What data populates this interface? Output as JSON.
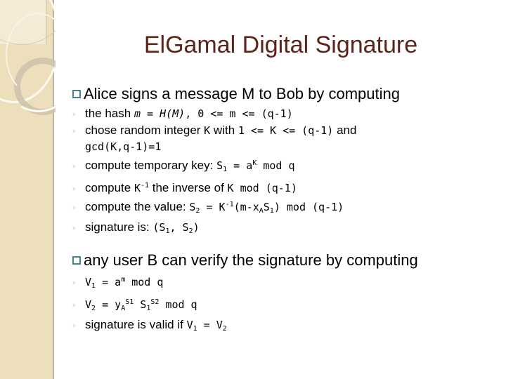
{
  "slide": {
    "title": "ElGamal Digital Signature",
    "title_color": "#5B2418",
    "background_color": "#FFFFFF",
    "decoration": {
      "band_color": "#EDDFBC",
      "band_light_color": "#F4EBD6",
      "ring_color": "#CCC2AB",
      "highlight_color": "#FDFAF1",
      "border_color": "#B9B4A2"
    },
    "bullet_markers": {
      "level1": "hollow-square",
      "level1_color": "#4A7F8C",
      "level2": "◦",
      "level2_color": "#9FB4BD"
    }
  },
  "sections": [
    {
      "heading": "Alice signs a message M to Bob by computing",
      "items": [
        {
          "parts": [
            {
              "style": "text",
              "t": "the hash "
            },
            {
              "style": "mono-italic",
              "t": "m"
            },
            {
              "style": "mono",
              "t": " = "
            },
            {
              "style": "mono-italic",
              "t": "H(M)"
            },
            {
              "style": "mono",
              "t": ", 0 <= m <= (q-1)"
            }
          ],
          "plain": "the hash m = H(M), 0 <= m <= (q-1)"
        },
        {
          "parts": [
            {
              "style": "text",
              "t": "chose random integer "
            },
            {
              "style": "mono",
              "t": "K"
            },
            {
              "style": "text",
              "t": " with "
            },
            {
              "style": "mono",
              "t": "1 <= K <= (q-1)"
            },
            {
              "style": "text",
              "t": " and"
            }
          ],
          "plain": "chose random integer K with 1 <= K <= (q-1) and",
          "continuation": "gcd(K,q-1)=1"
        },
        {
          "parts": [
            {
              "style": "text",
              "t": "compute temporary key: "
            },
            {
              "style": "mono",
              "t": "S1 = aK mod q"
            }
          ],
          "plain": "compute temporary key: S1 = a^K mod q"
        },
        {
          "parts": [
            {
              "style": "text",
              "t": "compute "
            },
            {
              "style": "mono",
              "t": "K-1"
            },
            {
              "style": "text",
              "t": " the inverse of "
            },
            {
              "style": "mono",
              "t": "K mod (q-1)"
            }
          ],
          "plain": "compute K-1 the inverse of K mod (q-1)"
        },
        {
          "parts": [
            {
              "style": "text",
              "t": "compute the value: "
            },
            {
              "style": "mono",
              "t": "S2 = K-1(m-xAS1) mod (q-1)"
            }
          ],
          "plain": "compute the value: S2 = K-1(m-xAS1) mod (q-1)"
        },
        {
          "parts": [
            {
              "style": "text",
              "t": "signature is: "
            },
            {
              "style": "mono",
              "t": "(S1, S2)"
            }
          ],
          "plain": "signature is: (S1, S2)"
        }
      ]
    },
    {
      "heading": "any user B can verify the signature by computing",
      "items": [
        {
          "plain": "V1 = am mod q"
        },
        {
          "plain": "V2 = yAS1 S1S2 mod q"
        },
        {
          "plain": "signature is valid if V1 = V2"
        }
      ]
    }
  ],
  "text": {
    "hash_label": "the hash ",
    "m_var": "m",
    "eq": " = ",
    "hm": "H(M)",
    "hash_range": ", 0 <= m <= (q-1)",
    "chose_label": "chose random integer ",
    "K_var": "K",
    "with_label": " with ",
    "K_range": "1 <= K <= (q-1)",
    "and_label": " and",
    "gcd_line": "gcd(K,q-1)=1",
    "tempkey_label": "compute temporary key: ",
    "S_letter": "S",
    "one": "1",
    "two": "2",
    "eq2": " = ",
    "a_letter": "a",
    "K_sup": "K",
    "mod_q": " mod q",
    "compute_label": "compute ",
    "K_inv": "K",
    "minus_one": "-1",
    "inverse_label": " the inverse of ",
    "K_mod": "K mod (q-1)",
    "value_label": "compute the value: ",
    "val_eq": " = ",
    "val_open": "(m-x",
    "A_sub": "A",
    "val_close": ") mod (q-1)",
    "sig_label": "signature is: ",
    "sig_open": "(",
    "sig_comma": ", ",
    "sig_close": ")",
    "V_letter": "V",
    "v1_eq": " = ",
    "a_m": "a",
    "m_sup": "m",
    "v1_modq": " mod q",
    "y_letter": "y",
    "yA_sub": "A",
    "S1_sup": "S1",
    "S2_sup": "S2",
    "v2_modq": " mod q",
    "space": " ",
    "valid_label": "signature is valid if ",
    "valid_eq": " = "
  }
}
